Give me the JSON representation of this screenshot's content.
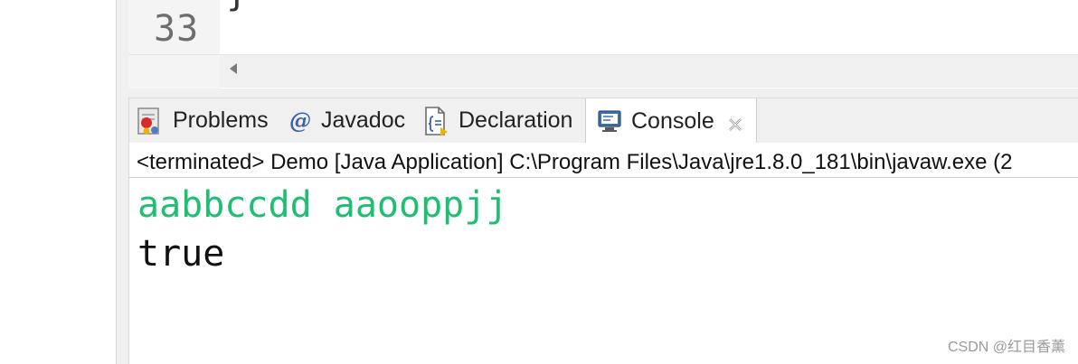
{
  "editor": {
    "prev_line_fragment": "}",
    "line_number": "33"
  },
  "tabs": [
    {
      "label": "Problems",
      "icon": "problems-icon"
    },
    {
      "label": "Javadoc",
      "icon": "javadoc-at-icon"
    },
    {
      "label": "Declaration",
      "icon": "declaration-icon"
    },
    {
      "label": "Console",
      "icon": "console-icon",
      "active": true
    }
  ],
  "console": {
    "status": "<terminated> Demo [Java Application] C:\\Program Files\\Java\\jre1.8.0_181\\bin\\javaw.exe  (2",
    "output": [
      "aabbccdd aaooppjj",
      "true"
    ]
  },
  "watermark": "CSDN @红目香薰",
  "colors": {
    "output_green": "#1fbf73",
    "javadoc_blue": "#3a62a8",
    "panel_bg": "#f0f0f0"
  }
}
